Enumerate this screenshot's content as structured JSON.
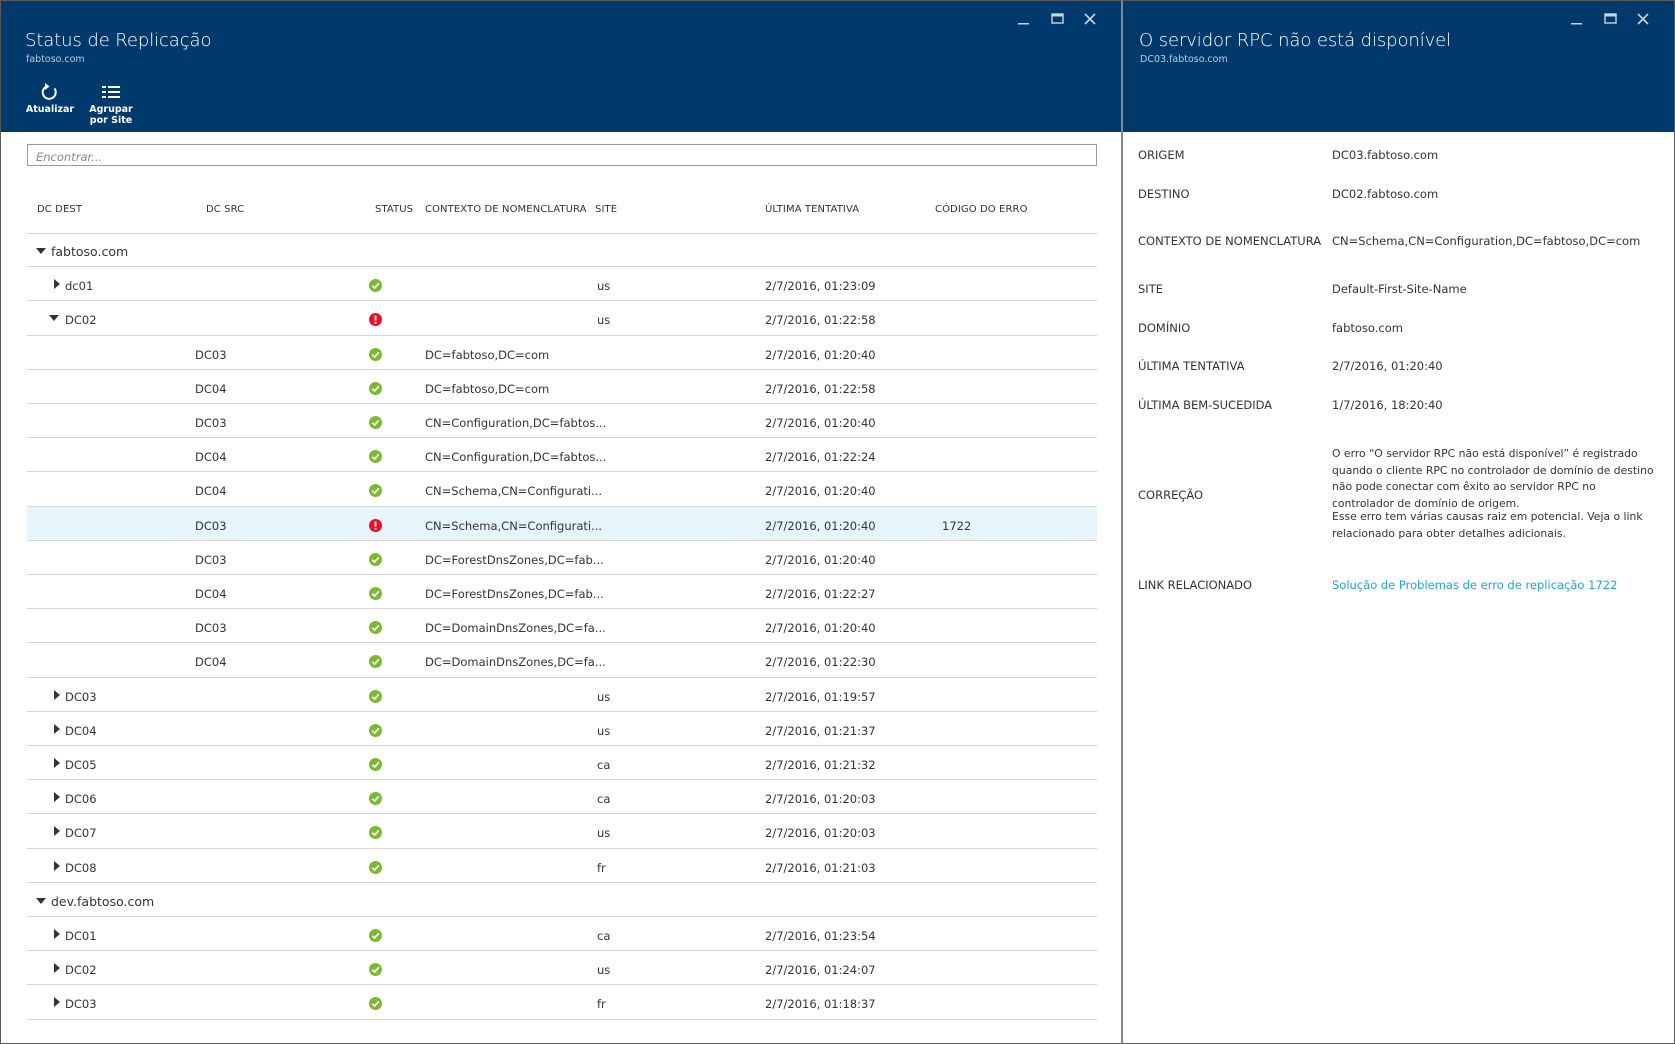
{
  "colors": {
    "header_bg": "#003a6c",
    "selected_row": "#e6f4fb",
    "ok": "#7db92e",
    "error": "#e8112d",
    "link": "#1da4dc"
  },
  "left_blade": {
    "title": "Status de Replicação",
    "subtitle": "fabtoso.com",
    "window_controls": [
      "minimize-icon",
      "maximize-icon",
      "close-icon"
    ],
    "commands": [
      {
        "label": "Atualizar",
        "icon": "refresh-icon"
      },
      {
        "label": "Agrupar\npor Site",
        "icon": "group-by-site-icon"
      }
    ],
    "search": {
      "placeholder": "Encontrar..."
    },
    "columns": [
      "DC DEST",
      "DC SRC",
      "STATUS",
      "CONTEXTO DE NOMENCLATURA",
      "SITE",
      "ÚLTIMA TENTATIVA",
      "CÓDIGO DO ERRO"
    ],
    "rows": [
      {
        "type": "group",
        "name": "fabtoso.com",
        "expanded": true
      },
      {
        "type": "dest",
        "dest": "dc01",
        "status": "ok",
        "site": "us",
        "last": "2/7/2016, 01:23:09",
        "expanded": false
      },
      {
        "type": "dest",
        "dest": "DC02",
        "status": "error",
        "site": "us",
        "last": "2/7/2016, 01:22:58",
        "expanded": true
      },
      {
        "type": "src",
        "src": "DC03",
        "status": "ok",
        "context": "DC=fabtoso,DC=com",
        "last": "2/7/2016, 01:20:40"
      },
      {
        "type": "src",
        "src": "DC04",
        "status": "ok",
        "context": "DC=fabtoso,DC=com",
        "last": "2/7/2016, 01:22:58"
      },
      {
        "type": "src",
        "src": "DC03",
        "status": "ok",
        "context": "CN=Configuration,DC=fabtos...",
        "last": "2/7/2016, 01:20:40"
      },
      {
        "type": "src",
        "src": "DC04",
        "status": "ok",
        "context": "CN=Configuration,DC=fabtos...",
        "last": "2/7/2016, 01:22:24"
      },
      {
        "type": "src",
        "src": "DC04",
        "status": "ok",
        "context": "CN=Schema,CN=Configurati...",
        "last": "2/7/2016, 01:20:40"
      },
      {
        "type": "src",
        "src": "DC03",
        "status": "error",
        "context": "CN=Schema,CN=Configurati...",
        "last": "2/7/2016, 01:20:40",
        "error": "1722",
        "selected": true
      },
      {
        "type": "src",
        "src": "DC03",
        "status": "ok",
        "context": "DC=ForestDnsZones,DC=fab...",
        "last": "2/7/2016, 01:20:40"
      },
      {
        "type": "src",
        "src": "DC04",
        "status": "ok",
        "context": "DC=ForestDnsZones,DC=fab...",
        "last": "2/7/2016, 01:22:27"
      },
      {
        "type": "src",
        "src": "DC03",
        "status": "ok",
        "context": "DC=DomainDnsZones,DC=fa...",
        "last": "2/7/2016, 01:20:40"
      },
      {
        "type": "src",
        "src": "DC04",
        "status": "ok",
        "context": "DC=DomainDnsZones,DC=fa...",
        "last": "2/7/2016, 01:22:30"
      },
      {
        "type": "dest",
        "dest": "DC03",
        "status": "ok",
        "site": "us",
        "last": "2/7/2016, 01:19:57",
        "expanded": false
      },
      {
        "type": "dest",
        "dest": "DC04",
        "status": "ok",
        "site": "us",
        "last": "2/7/2016, 01:21:37",
        "expanded": false
      },
      {
        "type": "dest",
        "dest": "DC05",
        "status": "ok",
        "site": "ca",
        "last": "2/7/2016, 01:21:32",
        "expanded": false
      },
      {
        "type": "dest",
        "dest": "DC06",
        "status": "ok",
        "site": "ca",
        "last": "2/7/2016, 01:20:03",
        "expanded": false
      },
      {
        "type": "dest",
        "dest": "DC07",
        "status": "ok",
        "site": "us",
        "last": "2/7/2016, 01:20:03",
        "expanded": false
      },
      {
        "type": "dest",
        "dest": "DC08",
        "status": "ok",
        "site": "fr",
        "last": "2/7/2016, 01:21:03",
        "expanded": false
      },
      {
        "type": "group",
        "name": "dev.fabtoso.com",
        "expanded": true
      },
      {
        "type": "dest",
        "dest": "DC01",
        "status": "ok",
        "site": "ca",
        "last": "2/7/2016, 01:23:54",
        "expanded": false
      },
      {
        "type": "dest",
        "dest": "DC02",
        "status": "ok",
        "site": "us",
        "last": "2/7/2016, 01:24:07",
        "expanded": false
      },
      {
        "type": "dest",
        "dest": "DC03",
        "status": "ok",
        "site": "fr",
        "last": "2/7/2016, 01:18:37",
        "expanded": false
      }
    ]
  },
  "right_blade": {
    "title": "O servidor RPC não está disponível",
    "subtitle": "DC03.fabtoso.com",
    "window_controls": [
      "minimize-icon",
      "maximize-icon",
      "close-icon"
    ],
    "properties": {
      "origem": {
        "label": "ORIGEM",
        "value": "DC03.fabtoso.com"
      },
      "destino": {
        "label": "DESTINO",
        "value": "DC02.fabtoso.com"
      },
      "contexto": {
        "label": "CONTEXTO DE NOMENCLATURA",
        "value": "CN=Schema,CN=Configuration,DC=fabtoso,DC=com"
      },
      "site": {
        "label": "SITE",
        "value": "Default-First-Site-Name"
      },
      "dominio": {
        "label": "DOMÍNIO",
        "value": "fabtoso.com"
      },
      "ultima_tentativa": {
        "label": "ÚLTIMA TENTATIVA",
        "value": "2/7/2016, 01:20:40"
      },
      "ultima_bem_sucedida": {
        "label": "ÚLTIMA BEM-SUCEDIDA",
        "value": "1/7/2016, 18:20:40"
      },
      "correcao": {
        "label": "CORREÇÃO",
        "paragraph1": "O erro “O servidor RPC não está disponível” é registrado quando o cliente RPC no controlador de domínio de destino não pode conectar com êxito ao servidor RPC no controlador de domínio de origem.",
        "paragraph2": "Esse erro tem várias causas raiz em potencial. Veja o link relacionado para obter detalhes adicionais."
      },
      "link": {
        "label": "LINK RELACIONADO",
        "value": "Solução de Problemas de erro de replicação 1722"
      }
    }
  }
}
